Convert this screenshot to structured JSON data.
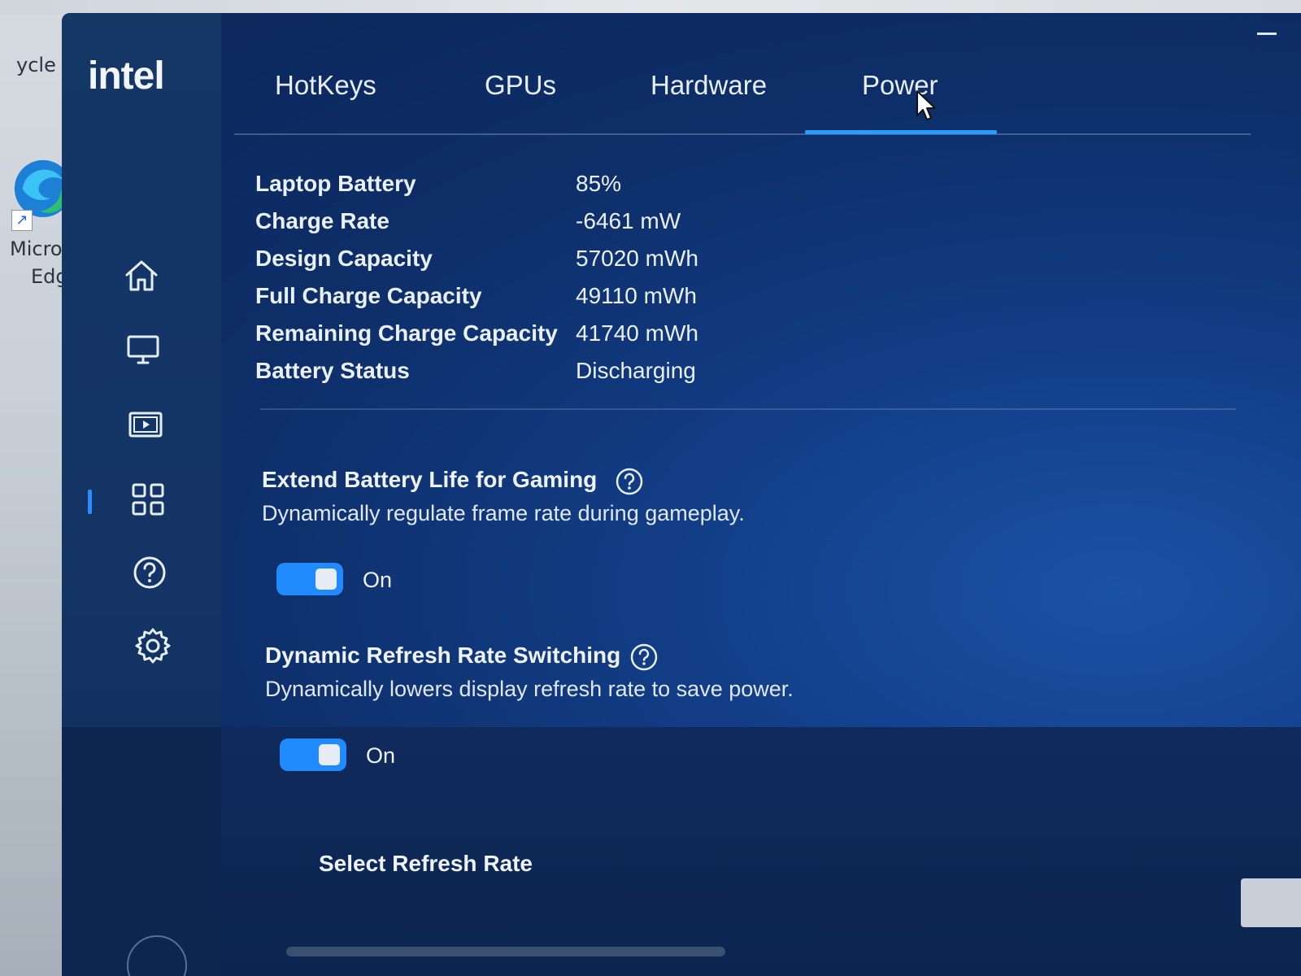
{
  "desktop": {
    "recycle_label": "ycle",
    "edge_label_line1": "Micros",
    "edge_label_line2": "Edg"
  },
  "app": {
    "logo": "intel",
    "accent_color": "#2b9bff"
  },
  "sidebar": {
    "items": [
      {
        "icon": "home-icon"
      },
      {
        "icon": "display-icon"
      },
      {
        "icon": "video-icon"
      },
      {
        "icon": "apps-grid-icon",
        "active": true
      },
      {
        "icon": "help-icon"
      },
      {
        "icon": "gear-icon"
      }
    ]
  },
  "tabs": [
    {
      "label": "HotKeys"
    },
    {
      "label": "GPUs"
    },
    {
      "label": "Hardware"
    },
    {
      "label": "Power",
      "active": true
    }
  ],
  "battery": {
    "rows": [
      {
        "label": "Laptop Battery",
        "value": "85%"
      },
      {
        "label": "Charge Rate",
        "value": "-6461 mW"
      },
      {
        "label": "Design Capacity",
        "value": "57020 mWh"
      },
      {
        "label": "Full Charge Capacity",
        "value": "49110 mWh"
      },
      {
        "label": "Remaining Charge Capacity",
        "value": "41740 mWh"
      },
      {
        "label": "Battery Status",
        "value": "Discharging"
      }
    ]
  },
  "settings": {
    "extend_battery": {
      "title": "Extend Battery Life for Gaming",
      "description": "Dynamically regulate frame rate during gameplay.",
      "state_label": "On",
      "enabled": true
    },
    "dynamic_refresh": {
      "title": "Dynamic Refresh Rate Switching",
      "description": "Dynamically lowers display refresh rate to save power.",
      "state_label": "On",
      "enabled": true
    },
    "select_refresh_rate_label": "Select Refresh Rate"
  }
}
